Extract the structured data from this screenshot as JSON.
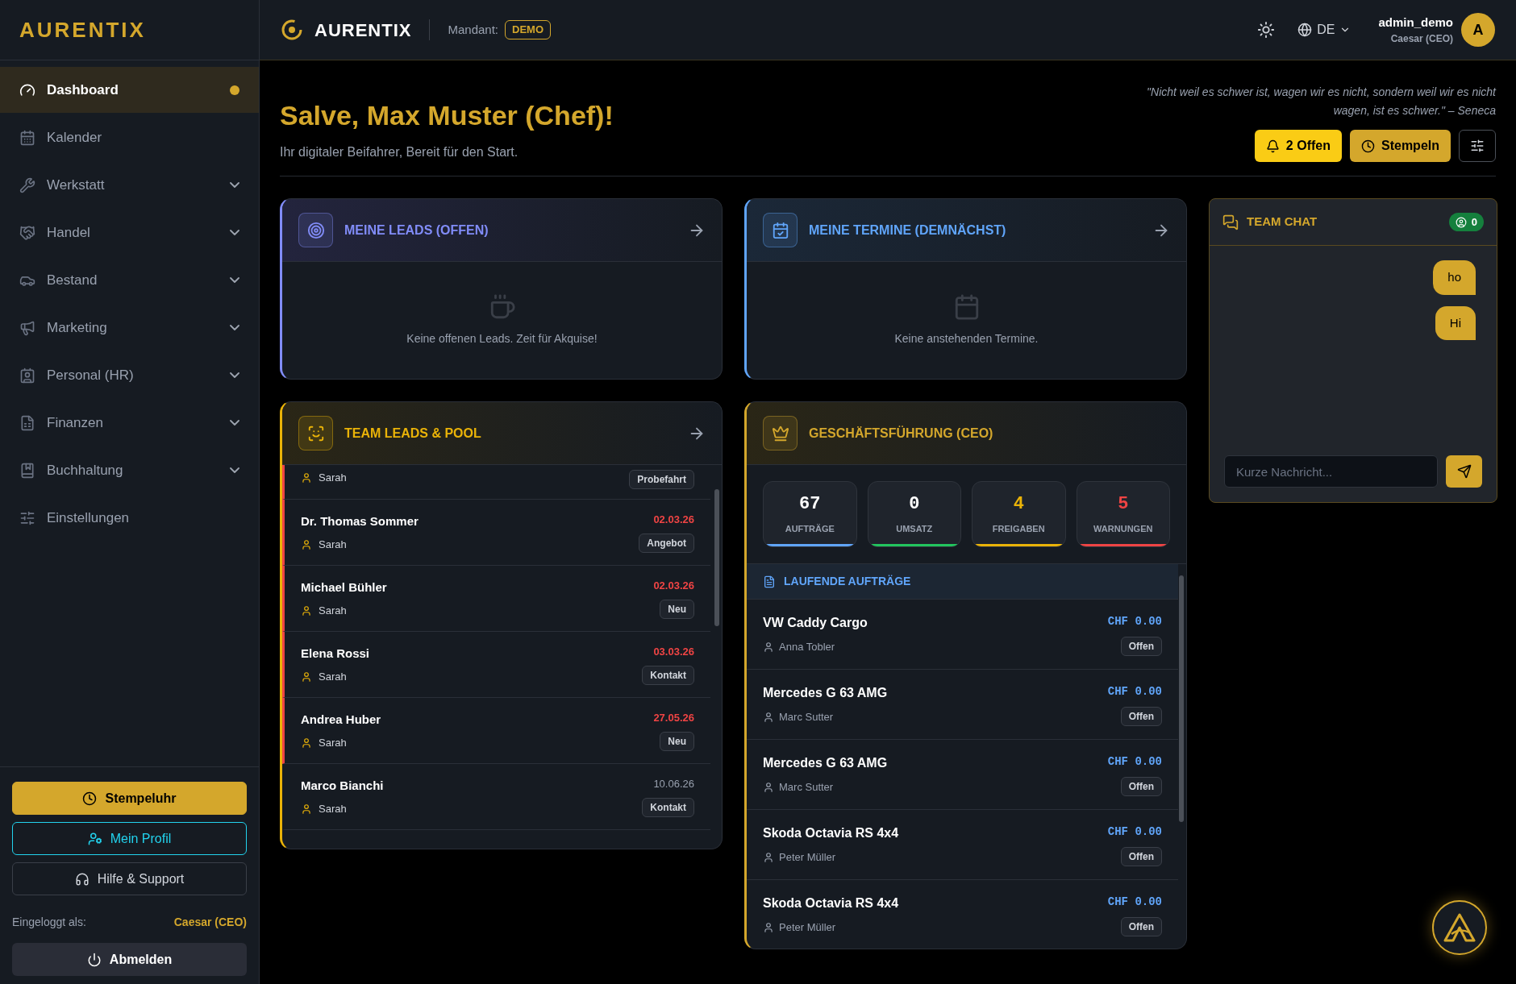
{
  "sidebar": {
    "brand": "AURENTIX",
    "nav": [
      {
        "label": "Dashboard",
        "kind": "link",
        "selected": true
      },
      {
        "label": "Kalender",
        "kind": "link",
        "selected": false
      },
      {
        "label": "Werkstatt",
        "kind": "group",
        "selected": false
      },
      {
        "label": "Handel",
        "kind": "group",
        "selected": false
      },
      {
        "label": "Bestand",
        "kind": "group",
        "selected": false
      },
      {
        "label": "Marketing",
        "kind": "group",
        "selected": false
      },
      {
        "label": "Personal (HR)",
        "kind": "group",
        "selected": false
      },
      {
        "label": "Finanzen",
        "kind": "group",
        "selected": false
      },
      {
        "label": "Buchhaltung",
        "kind": "group",
        "selected": false
      },
      {
        "label": "Einstellungen",
        "kind": "link",
        "selected": false
      }
    ],
    "buttons": [
      "Stempeluhr",
      "Mein Profil",
      "Hilfe & Support"
    ],
    "logged_in_label": "Eingeloggt als:",
    "logged_in_user": "Caesar (CEO)",
    "logout": "Abmelden"
  },
  "header": {
    "brand": "AURENTIX",
    "mandant_label": "Mandant:",
    "mandant": "DEMO",
    "language": "DE",
    "user": "admin_demo",
    "role": "Caesar (CEO)",
    "avatar": "A"
  },
  "greeting": {
    "title": "Salve, Max Muster (Chef)!",
    "subtitle": "Ihr digitaler Beifahrer, Bereit für den Start.",
    "quote": "\"Nicht weil es schwer ist, wagen wir es nicht, sondern weil wir es nicht wagen, ist es schwer.\" – Seneca",
    "open_button": "2 Offen",
    "clock_button": "Stempeln"
  },
  "leads": {
    "title": "MEINE LEADS (OFFEN)",
    "empty": "Keine offenen Leads. Zeit für Akquise!"
  },
  "appointments": {
    "title": "MEINE TERMINE (DEMNÄCHST)",
    "empty": "Keine anstehenden Termine."
  },
  "team_leads": {
    "title": "TEAM LEADS & POOL",
    "rows": [
      {
        "owner": "Sarah",
        "status": "Probefahrt",
        "overdue": true
      },
      {
        "name": "Dr. Thomas Sommer",
        "owner": "Sarah",
        "date": "02.03.26",
        "status": "Angebot",
        "overdue": true
      },
      {
        "name": "Michael Bühler",
        "owner": "Sarah",
        "date": "02.03.26",
        "status": "Neu",
        "overdue": true
      },
      {
        "name": "Elena Rossi",
        "owner": "Sarah",
        "date": "03.03.26",
        "status": "Kontakt",
        "overdue": true
      },
      {
        "name": "Andrea Huber",
        "owner": "Sarah",
        "date": "27.05.26",
        "status": "Neu",
        "overdue": true
      },
      {
        "name": "Marco Bianchi",
        "owner": "Sarah",
        "date": "10.06.26",
        "status": "Kontakt",
        "overdue": false
      }
    ]
  },
  "ceo": {
    "title": "GESCHÄFTSFÜHRUNG (CEO)",
    "stats": [
      {
        "value": "67",
        "label": "AUFTRÄGE",
        "color": "#60a5fa",
        "highlight": false
      },
      {
        "value": "0",
        "label": "UMSATZ",
        "color": "#22c55e",
        "highlight": false
      },
      {
        "value": "4",
        "label": "FREIGABEN",
        "color": "#eab308",
        "highlight": true
      },
      {
        "value": "5",
        "label": "WARNUNGEN",
        "color": "#ef4444",
        "highlight": true
      }
    ],
    "section": "LAUFENDE AUFTRÄGE",
    "orders": [
      {
        "title": "VW Caddy Cargo",
        "person": "Anna Tobler",
        "amount": "CHF 0.00",
        "status": "Offen"
      },
      {
        "title": "Mercedes G 63 AMG",
        "person": "Marc Sutter",
        "amount": "CHF 0.00",
        "status": "Offen"
      },
      {
        "title": "Mercedes G 63 AMG",
        "person": "Marc Sutter",
        "amount": "CHF 0.00",
        "status": "Offen"
      },
      {
        "title": "Skoda Octavia RS 4x4",
        "person": "Peter Müller",
        "amount": "CHF 0.00",
        "status": "Offen"
      },
      {
        "title": "Skoda Octavia RS 4x4",
        "person": "Peter Müller",
        "amount": "CHF 0.00",
        "status": "Offen"
      }
    ]
  },
  "chat": {
    "title": "TEAM CHAT",
    "online": "0",
    "messages": [
      "ho",
      "Hi"
    ],
    "placeholder": "Kurze Nachricht..."
  }
}
